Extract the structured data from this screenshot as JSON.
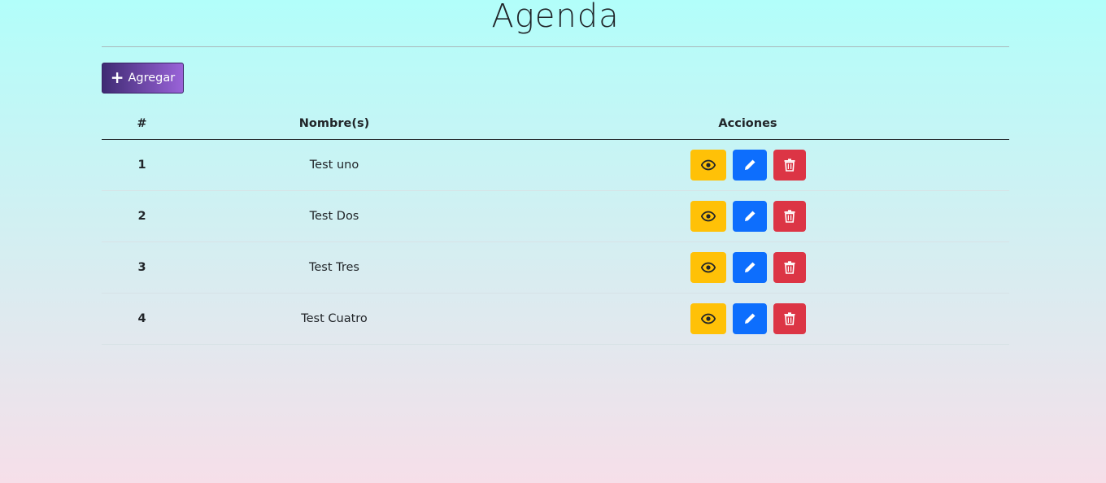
{
  "page": {
    "title": "Agenda"
  },
  "toolbar": {
    "add_label": "Agregar",
    "add_icon": "plus-icon"
  },
  "table": {
    "headers": [
      "#",
      "Nombre(s)",
      "Acciones"
    ],
    "rows": [
      {
        "num": "1",
        "name": "Test uno"
      },
      {
        "num": "2",
        "name": "Test Dos"
      },
      {
        "num": "3",
        "name": "Test Tres"
      },
      {
        "num": "4",
        "name": "Test Cuatro"
      }
    ]
  },
  "actions": {
    "view": {
      "icon": "eye-icon",
      "color": "#ffc107"
    },
    "edit": {
      "icon": "pencil-icon",
      "color": "#0d6efd"
    },
    "delete": {
      "icon": "trash-icon",
      "color": "#dc3545"
    }
  },
  "theme": {
    "gradient_top": "#b2fefa",
    "gradient_bottom": "#f6dfe9",
    "add_button_start": "#3f2b73",
    "add_button_end": "#9a63d9"
  }
}
